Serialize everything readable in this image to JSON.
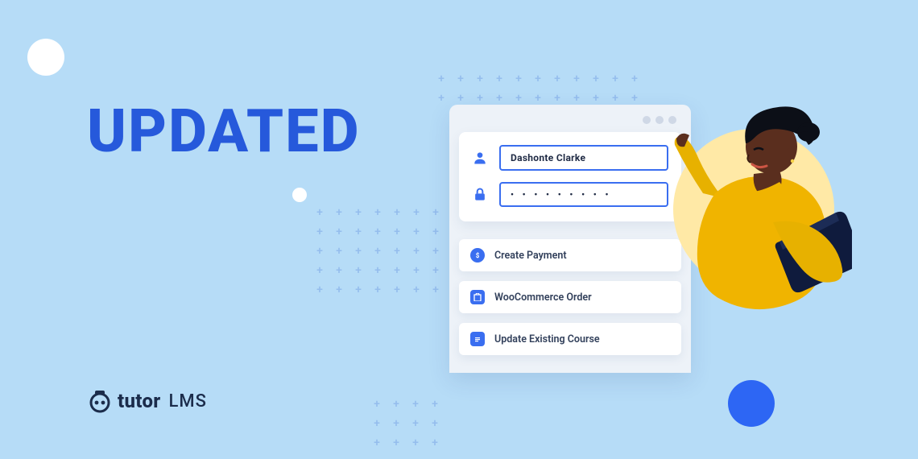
{
  "headline": "UPDATED",
  "logo": {
    "name": "tutor",
    "suffix": "LMS"
  },
  "login": {
    "username": "Dashonte Clarke",
    "password_mask": "• • • • • • • • •"
  },
  "actions": [
    {
      "icon": "dollar",
      "label": "Create Payment"
    },
    {
      "icon": "bag",
      "label": "WooCommerce Order"
    },
    {
      "icon": "doc",
      "label": "Update Existing Course"
    }
  ],
  "colors": {
    "accent": "#3a6ef0",
    "panel": "#edf2f8",
    "bg": "#b6dcf7"
  }
}
